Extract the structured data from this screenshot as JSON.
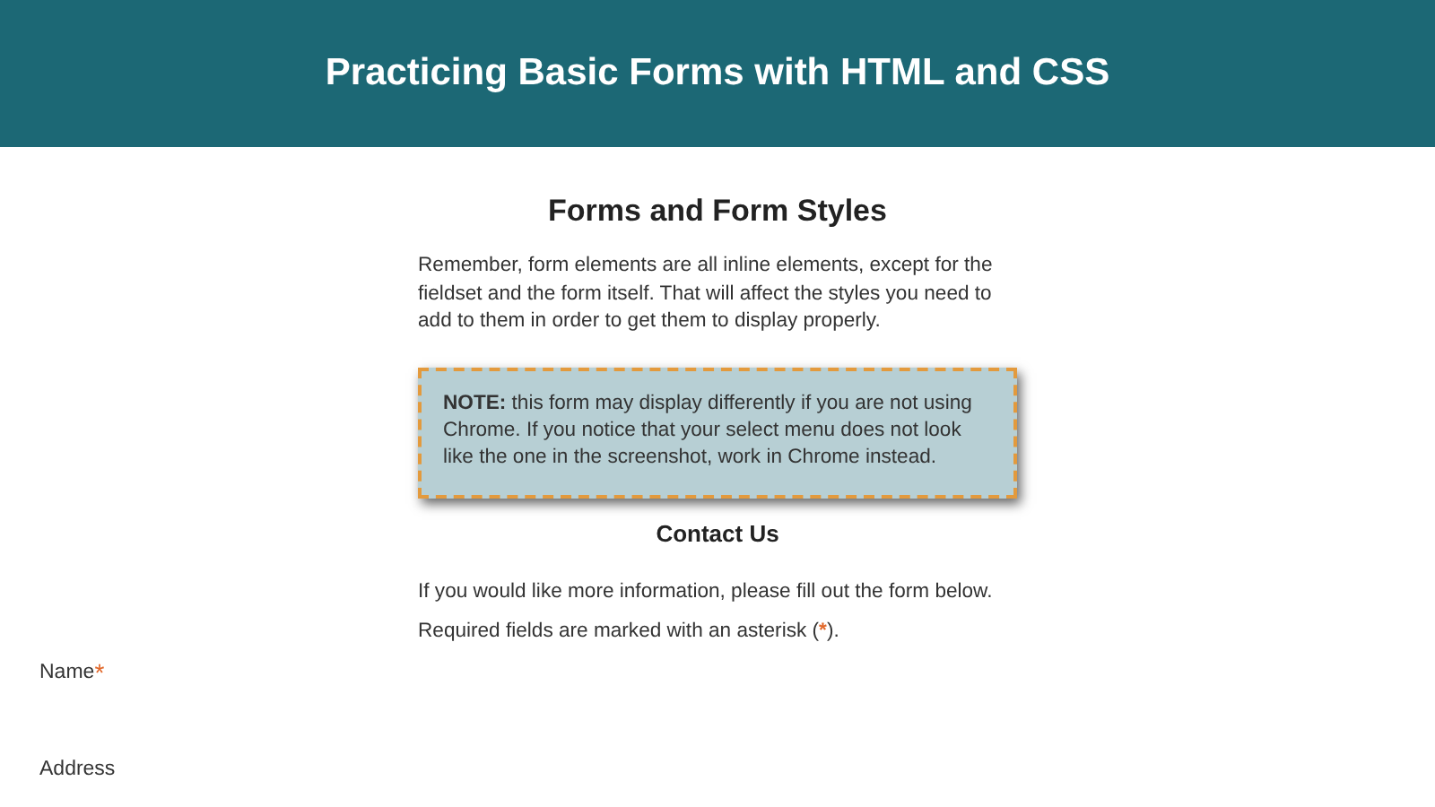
{
  "header": {
    "title": "Practicing Basic Forms with HTML and CSS"
  },
  "section": {
    "heading": "Forms and Form Styles",
    "intro": "Remember, form elements are all inline elements, except for the fieldset and the form itself. That will affect the styles you need to add to them in order to get them to display properly.",
    "note": "**NOTE:** this form may display differently if you are not using Chrome. If you notice that your select menu does not look like the one in the screenshot, work in Chrome instead."
  },
  "contact": {
    "heading": "Contact Us",
    "text_before": "If you would like more information, please fill out the form below. Required fields are marked with an asterisk (",
    "asterisk": "*",
    "text_after": ")."
  },
  "fields": [
    {
      "label": "Name",
      "marker": "*"
    },
    {
      "label": "Address"
    }
  ]
}
